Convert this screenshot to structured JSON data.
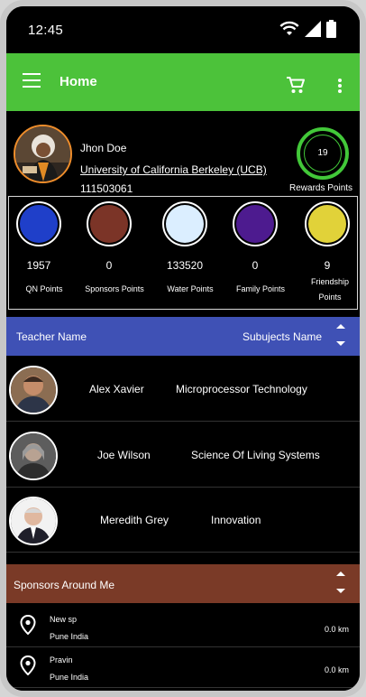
{
  "status_bar": {
    "time": "12:45"
  },
  "app_bar": {
    "title": "Home",
    "menu_icon": "menu-icon",
    "cart_icon": "cart-icon",
    "more_icon": "more-vert-icon"
  },
  "profile": {
    "name": "Jhon Doe",
    "university": "University of California Berkeley (UCB)",
    "id": "111503061",
    "rewards": {
      "value": "19",
      "label": "Rewards Points",
      "ring_color": "#42c839"
    }
  },
  "points": [
    {
      "value": "1957",
      "label": "QN Points",
      "color": "#1f3fc9"
    },
    {
      "value": "0",
      "label": "Sponsors Points",
      "color": "#7b3427"
    },
    {
      "value": "133520",
      "label": "Water Points",
      "color": "#dbeeff"
    },
    {
      "value": "0",
      "label": "Family Points",
      "color": "#4d1b8f"
    },
    {
      "value": "9",
      "label": "Friendship Points",
      "color": "#e1d239"
    }
  ],
  "teachers": {
    "header": {
      "name_label": "Teacher Name",
      "subject_label": "Subujects Name",
      "color": "#3f51b5"
    },
    "rows": [
      {
        "name": "Alex Xavier",
        "subject": "Microprocessor Technology"
      },
      {
        "name": "Joe Wilson",
        "subject": "Science Of Living Systems"
      },
      {
        "name": "Meredith Grey",
        "subject": "Innovation"
      }
    ]
  },
  "sponsors": {
    "header": {
      "label": "Sponsors Around Me",
      "color": "#7a3a27"
    },
    "rows": [
      {
        "name": "New sp",
        "location": "Pune India",
        "distance": "0.0 km"
      },
      {
        "name": "Pravin",
        "location": "Pune India",
        "distance": "0.0 km"
      }
    ]
  }
}
